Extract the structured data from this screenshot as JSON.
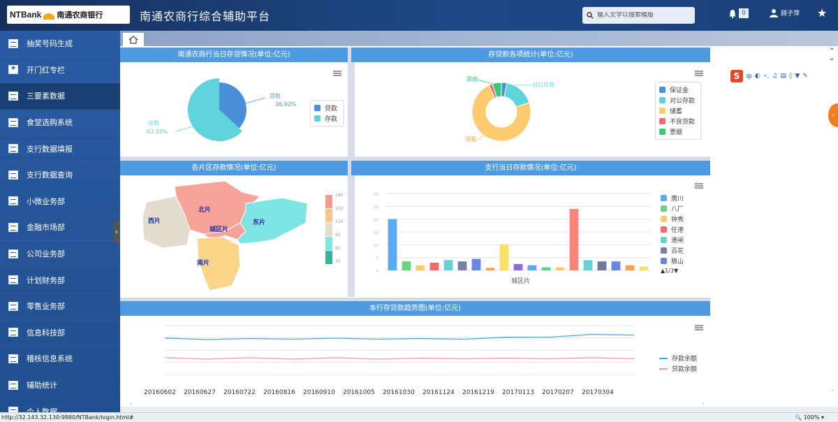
{
  "header": {
    "logo_en": "NTBank",
    "logo_cn": "南通农商银行",
    "title": "南通农商行综合辅助平台",
    "search_placeholder": "输入文字以搜索模版",
    "notification_count": "0",
    "user_name": "顾子萍"
  },
  "sidebar": {
    "items": [
      {
        "label": "抽奖号码生成",
        "icon": "doc-icon"
      },
      {
        "label": "开门红专栏",
        "icon": "star-icon"
      },
      {
        "label": "三要素数据",
        "icon": "doc-icon",
        "active": true
      },
      {
        "label": "食堂选购系统",
        "icon": "doc-icon"
      },
      {
        "label": "支行数据填报",
        "icon": "doc-icon"
      },
      {
        "label": "支行数据查询",
        "icon": "doc-icon"
      },
      {
        "label": "小微业务部",
        "icon": "doc-icon"
      },
      {
        "label": "金融市场部",
        "icon": "doc-icon"
      },
      {
        "label": "公司业务部",
        "icon": "doc-icon"
      },
      {
        "label": "计划财务部",
        "icon": "doc-icon"
      },
      {
        "label": "零售业务部",
        "icon": "doc-icon"
      },
      {
        "label": "信息科技部",
        "icon": "doc-icon"
      },
      {
        "label": "稽核信息系统",
        "icon": "doc-icon"
      },
      {
        "label": "辅助统计",
        "icon": "doc-icon"
      },
      {
        "label": "个人数据",
        "icon": "doc-icon"
      }
    ]
  },
  "tabs": {
    "home_icon": "home-icon"
  },
  "panels": {
    "p1_title": "南通农商行当日存贷情况(单位:亿元)",
    "p2_title": "存贷款各项统计(单位:亿元)",
    "p3_title": "各片区存款情况(单位:亿元)",
    "p4_title": "支行当日存款情况(单位:亿元)",
    "p5_title": "本行存贷款趋势图(单位:亿元)"
  },
  "chart_data": [
    {
      "type": "pie",
      "title": "南通农商行当日存贷情况(单位:亿元)",
      "slices": [
        {
          "name": "贷款",
          "pct": 36.92,
          "label": "贷款",
          "pct_label": "36.92%",
          "color": "#4a90d9"
        },
        {
          "name": "存款",
          "pct": 63.08,
          "label": "存款",
          "pct_label": "63.08%",
          "color": "#5fd3dc"
        }
      ],
      "legend": [
        "贷款",
        "存款"
      ]
    },
    {
      "type": "pie",
      "title": "存贷款各项统计(单位:亿元)",
      "donut": true,
      "slices": [
        {
          "name": "保证金",
          "pct": 3,
          "color": "#4a90d9"
        },
        {
          "name": "对公存款",
          "pct": 17,
          "color": "#5fd3dc"
        },
        {
          "name": "储蓄",
          "pct": 73,
          "color": "#fdcb6e"
        },
        {
          "name": "不良贷款",
          "pct": 2,
          "color": "#f26b6b"
        },
        {
          "name": "票据",
          "pct": 5,
          "color": "#3cc87a"
        }
      ],
      "legend": [
        "保证金",
        "对公存款",
        "储蓄",
        "不良贷款",
        "票据"
      ],
      "labels": [
        "票据",
        "对公存款",
        "储蓄"
      ]
    },
    {
      "type": "map",
      "title": "各片区存款情况(单位:亿元)",
      "regions": [
        {
          "name": "北片",
          "color": "#f8a39a"
        },
        {
          "name": "西片",
          "color": "#e4dccc"
        },
        {
          "name": "城区片",
          "color": "#f8a39a"
        },
        {
          "name": "东片",
          "color": "#7ee5e2"
        },
        {
          "name": "南片",
          "color": "#fdd58a"
        }
      ],
      "scale_labels": [
        "180",
        "150",
        "120",
        "90",
        "60",
        "30"
      ],
      "scale_colors": [
        "#f79b90",
        "#f8c58b",
        "#e3dccb",
        "#7ee5e2",
        "#3bb39a"
      ]
    },
    {
      "type": "bar",
      "title": "支行当日存款情况(单位:亿元)",
      "xlabel": "城区片",
      "ylim": [
        0,
        30
      ],
      "yticks": [
        "30",
        "25",
        "20",
        "15",
        "10",
        "5",
        "0"
      ],
      "values": [
        20,
        3.5,
        2,
        3,
        4,
        3.5,
        4.5,
        1,
        10,
        2.5,
        2,
        1.2,
        1.2,
        24,
        4,
        3.5,
        3.5,
        2,
        1.5
      ],
      "colors": [
        "#5aaaf0",
        "#6ad282",
        "#fdcb6e",
        "#f26b6b",
        "#66d2d2",
        "#7782a0",
        "#6b86e2",
        "#f6a35a",
        "#fbe066",
        "#8d6bd8",
        "#5aaaf0",
        "#5dcf8c",
        "#fdcb6e",
        "#f8867a",
        "#66d2d2",
        "#6a7a98",
        "#6b86e2",
        "#f6a35a",
        "#fbe066"
      ],
      "legend": [
        {
          "name": "唐川",
          "color": "#5aaaf0"
        },
        {
          "name": "八厂",
          "color": "#6ad282"
        },
        {
          "name": "钟秀",
          "color": "#fdcb6e"
        },
        {
          "name": "任港",
          "color": "#f26b6b"
        },
        {
          "name": "港闸",
          "color": "#66d2d2"
        },
        {
          "name": "百花",
          "color": "#7782a0"
        },
        {
          "name": "狼山",
          "color": "#6b86e2"
        }
      ],
      "page": "1/3"
    },
    {
      "type": "line",
      "title": "本行存贷款趋势图(单位:亿元)",
      "x": [
        "20160602",
        "20160627",
        "20160722",
        "20160816",
        "20160910",
        "20161005",
        "20161030",
        "20161124",
        "20161219",
        "20170113",
        "20170207",
        "20170304"
      ],
      "series": [
        {
          "name": "存款余额",
          "color": "#4aa8e0",
          "values": [
            88,
            87,
            87,
            88,
            88,
            88,
            87,
            88,
            90,
            93,
            97,
            98
          ]
        },
        {
          "name": "贷款余额",
          "color": "#f29a9a",
          "values": [
            40,
            39,
            40,
            39,
            40,
            39,
            39,
            40,
            39,
            40,
            40,
            40
          ]
        }
      ],
      "ylim": [
        0,
        120
      ],
      "ytick_count": 5
    }
  ],
  "statusbar": {
    "url": "http://32.143.32.130:9880/NTBank/login.html#",
    "zoom": "100%"
  }
}
